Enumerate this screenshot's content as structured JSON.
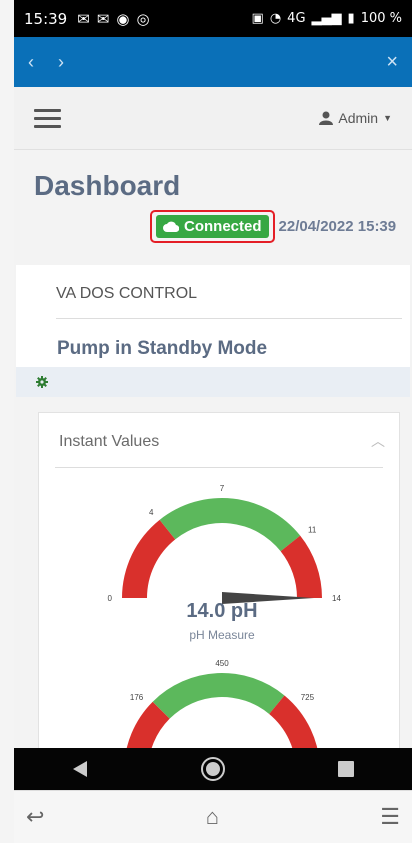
{
  "status_bar": {
    "time": "15:39",
    "battery": "100 %",
    "network": "4G"
  },
  "nav": {
    "back": "‹",
    "forward": "›",
    "close": "×"
  },
  "topbar": {
    "user": "Admin"
  },
  "page": {
    "title": "Dashboard",
    "connection": "Connected",
    "datetime": "22/04/2022 15:39"
  },
  "control": {
    "heading": "VA DOS CONTROL",
    "mode": "Pump in Standby Mode"
  },
  "instant": {
    "heading": "Instant Values",
    "gauge1": {
      "value": 14.0,
      "value_text": "14.0 pH",
      "label": "pH Measure",
      "min": 0,
      "max": 14,
      "ticks": [
        "0",
        "4",
        "7",
        "11",
        "14"
      ],
      "green_range": [
        4,
        11
      ]
    },
    "gauge2": {
      "min": 0,
      "ticks": [
        "176",
        "450",
        "725"
      ]
    }
  },
  "colors": {
    "red": "#d9302c",
    "green": "#5cb85c",
    "brand": "#0a70b8",
    "connected": "#37a843"
  }
}
